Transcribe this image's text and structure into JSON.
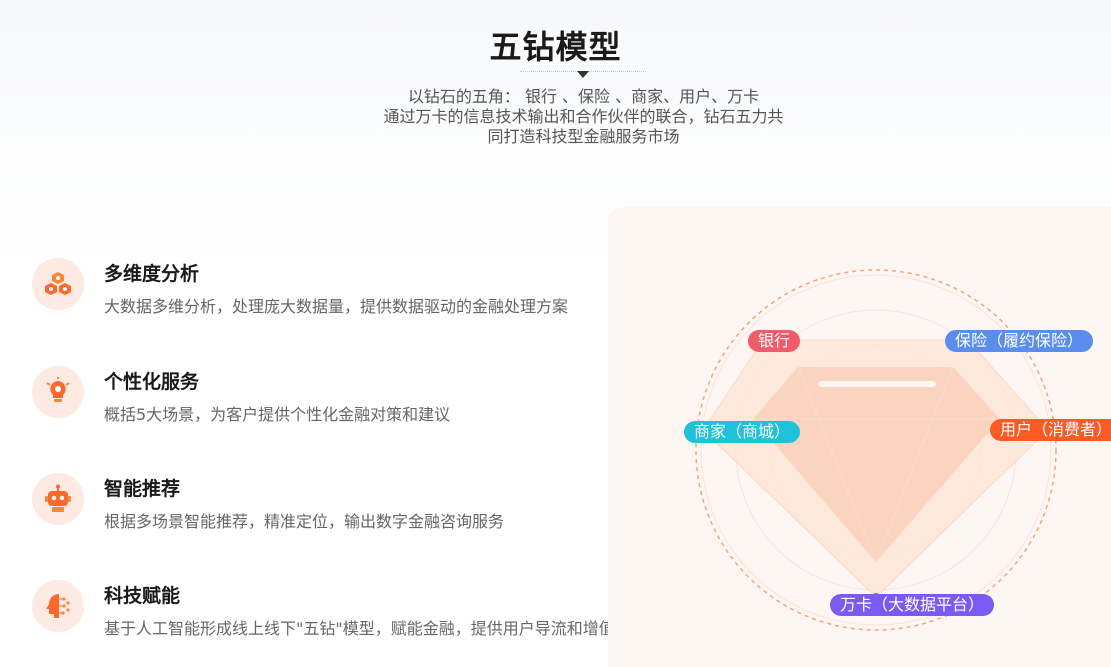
{
  "header": {
    "title": "五钻模型",
    "subtitle_lines": [
      "以钻石的五角： 银行 、保险 、商家、用户、万卡",
      "通过万卡的信息技术输出和合作伙伴的联合，钻石五力共",
      "同打造科技型金融服务市场"
    ]
  },
  "features": [
    {
      "title": "多维度分析",
      "desc": "大数据多维分析，处理庞大数据量，提供数据驱动的金融处理方案",
      "icon": "cubes-icon"
    },
    {
      "title": "个性化服务",
      "desc": "概括5大场景，为客户提供个性化金融对策和建议",
      "icon": "lightbulb-gear-icon"
    },
    {
      "title": "智能推荐",
      "desc": "根据多场景智能推荐，精准定位，输出数字金融咨询服务",
      "icon": "robot-icon"
    },
    {
      "title": "科技赋能",
      "desc": "基于人工智能形成线上线下\"五钻\"模型，赋能金融，提供用户导流和增值",
      "icon": "ai-head-icon"
    }
  ],
  "diagram": {
    "tags": [
      {
        "label": "银行",
        "color": "#ef5b6b"
      },
      {
        "label": "保险（履约保险）",
        "color": "#5b8def"
      },
      {
        "label": "商家（商城）",
        "color": "#1fc2d8"
      },
      {
        "label": "用户（消费者）",
        "color": "#fb5a24"
      },
      {
        "label": "万卡（大数据平台）",
        "color": "#7a5af2"
      }
    ],
    "accent": "#f7a27a"
  }
}
